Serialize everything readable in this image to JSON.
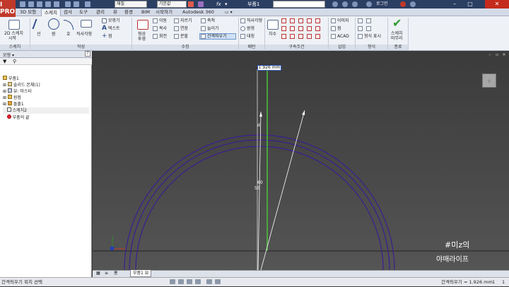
{
  "app": {
    "logo_label": "I PRO",
    "document_title": "부품1"
  },
  "quick_access": {
    "material": "재질",
    "appearance": "기본값",
    "equation_symbol": "fx"
  },
  "title_icons": [
    "search-icon",
    "help-icon",
    "user-icon"
  ],
  "login": "로그인",
  "window_controls": {
    "minimize": "–",
    "maximize": "▢",
    "close": "✕"
  },
  "tabs": [
    "3D 모형",
    "스케치",
    "검사",
    "도구",
    "관리",
    "뷰",
    "환경",
    "BIM",
    "시작하기",
    "Autodesk 360"
  ],
  "active_tab": "스케치",
  "ribbon": {
    "panels": [
      "스케치",
      "작성",
      "수정",
      "패턴",
      "구속조건",
      "삽입",
      "형식",
      "종료"
    ],
    "sketch": {
      "sketch2d_label_1": "2D 스케치",
      "sketch2d_label_2": "시작"
    },
    "create": {
      "line": "선",
      "circle": "원",
      "arc": "호",
      "rect": "직사각형",
      "fillet": "모깎기",
      "text": "텍스트",
      "point": "점"
    },
    "modify": {
      "project": "형상",
      "project_2": "투영",
      "move": "이동",
      "trim": "자르기",
      "scale": "축척",
      "copy": "복사",
      "extend": "연장",
      "stretch": "늘이기",
      "rotate": "회전",
      "split": "분할",
      "offset": "간격띄우기"
    },
    "pattern": {
      "rect": "직사각형",
      "circular": "원형",
      "mirror": "대칭"
    },
    "constraint": {
      "dimension": "치수"
    },
    "insert": {
      "image": "이미지",
      "points": "점",
      "acad": "ACAD"
    },
    "format": {
      "show_format": "형식 표시"
    },
    "finish": {
      "finish_1": "스케치",
      "finish_2": "마무리"
    }
  },
  "browser": {
    "title": "모형 ▾",
    "items": [
      "부품1",
      "솔리드 본체(1)",
      "뷰: 마스터",
      "원점",
      "돌출1",
      "스케치2",
      "부품의 끝"
    ]
  },
  "canvas": {
    "dimension_value": "1.926 mm",
    "dim_label_a": "60",
    "dim_label_b": "55",
    "watermark_line1": "#미z의",
    "watermark_line2": "야매라이프",
    "viewcube_label": "앞"
  },
  "doc_tabs": {
    "grid_icon": "▦",
    "list_icon": "≡",
    "home": "홈",
    "part": "부품1 ☒"
  },
  "status": {
    "left": "간격띄우기 위치 선택",
    "right": "간격띄우기 = 1.926 mm",
    "count_1": "1",
    "count_2": "1"
  }
}
